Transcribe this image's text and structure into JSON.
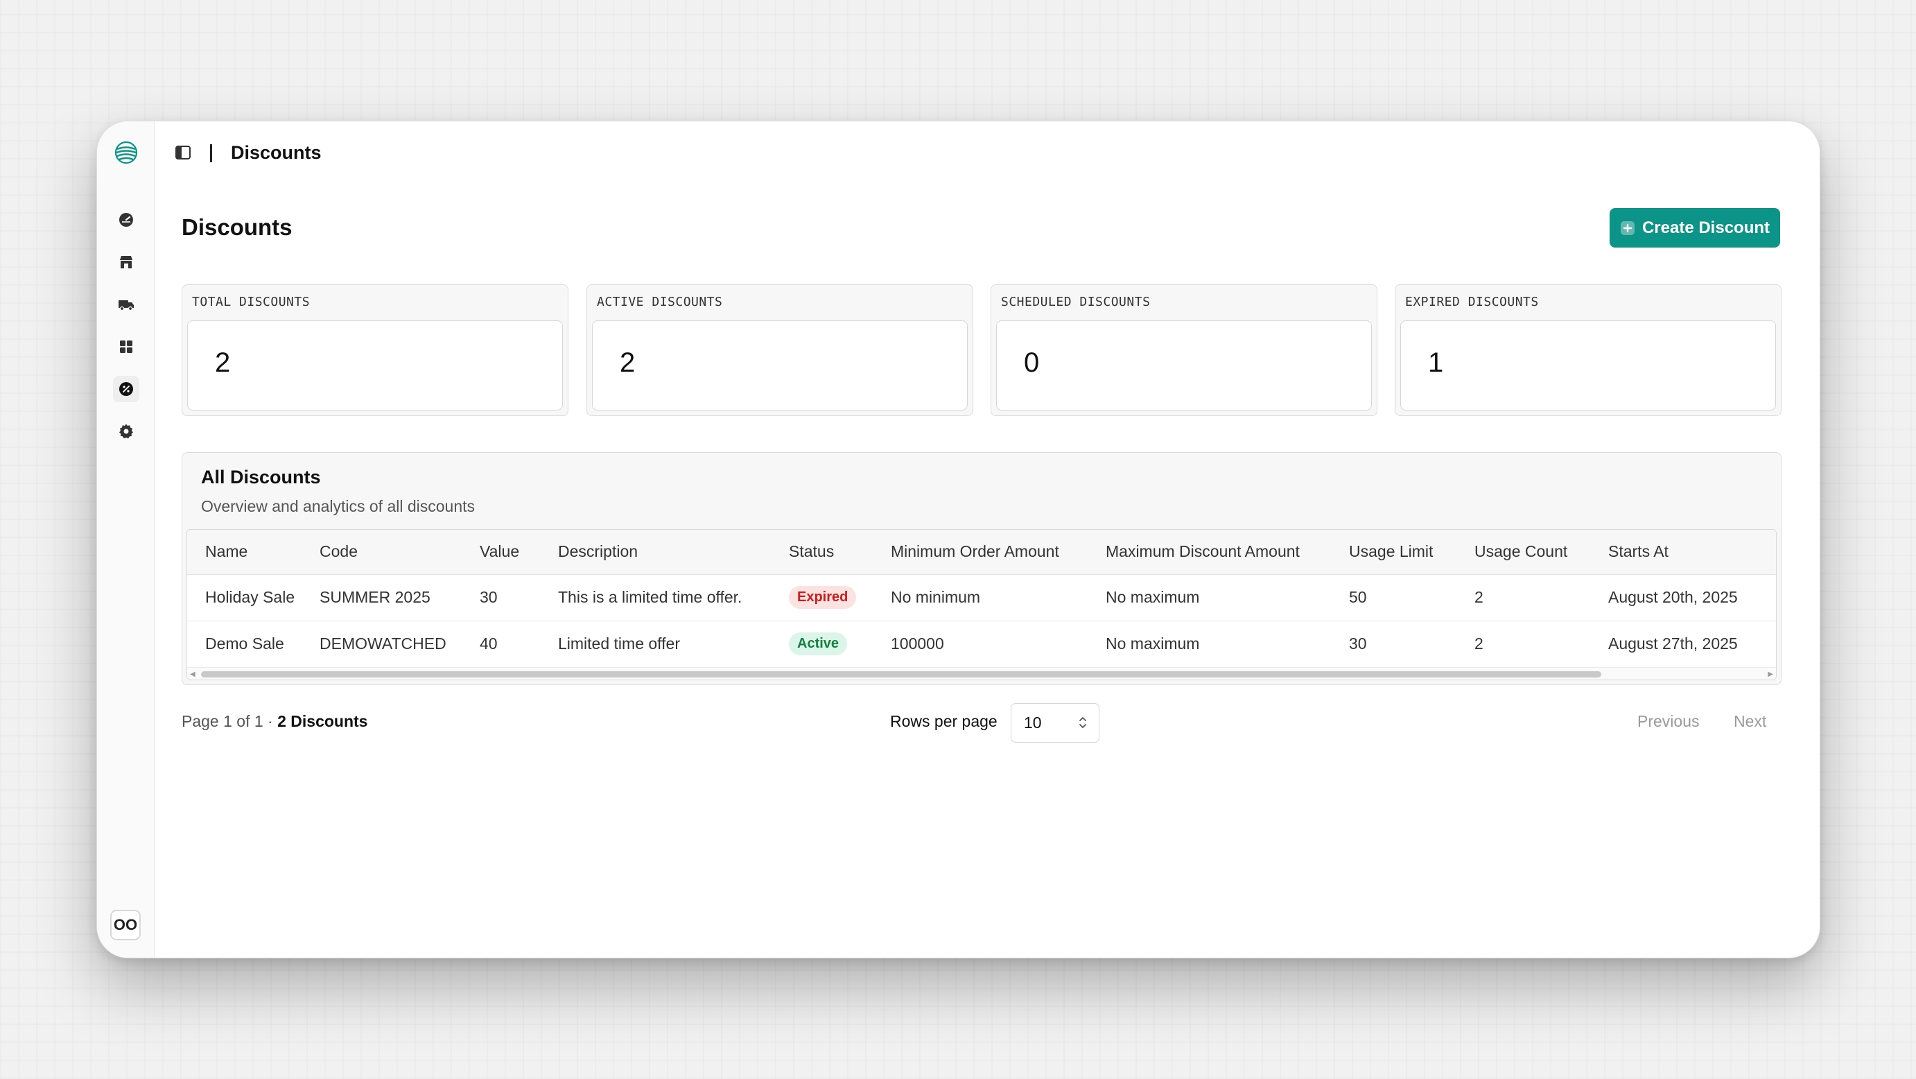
{
  "header": {
    "breadcrumb": "Discounts"
  },
  "page": {
    "title": "Discounts",
    "create_label": "Create Discount"
  },
  "stats": [
    {
      "label": "TOTAL DISCOUNTS",
      "value": "2"
    },
    {
      "label": "ACTIVE DISCOUNTS",
      "value": "2"
    },
    {
      "label": "SCHEDULED DISCOUNTS",
      "value": "0"
    },
    {
      "label": "EXPIRED DISCOUNTS",
      "value": "1"
    }
  ],
  "table": {
    "title": "All Discounts",
    "subtitle": "Overview and analytics of all discounts",
    "columns": [
      "Name",
      "Code",
      "Value",
      "Description",
      "Status",
      "Minimum Order Amount",
      "Maximum Discount Amount",
      "Usage Limit",
      "Usage Count",
      "Starts At"
    ],
    "rows": [
      [
        "Holiday Sale",
        "SUMMER 2025",
        "30",
        "This is a limited time offer.",
        "Expired",
        "No minimum",
        "No maximum",
        "50",
        "2",
        "August 20th, 2025"
      ],
      [
        "Demo Sale",
        "DEMOWATCHED",
        "40",
        "Limited time offer",
        "Active",
        "100000",
        "No maximum",
        "30",
        "2",
        "August 27th, 2025"
      ]
    ]
  },
  "pagination": {
    "page_text": "Page 1 of 1 · ",
    "count_text": "2 Discounts",
    "rows_per_page_label": "Rows per page",
    "rows_per_page_value": "10",
    "previous_label": "Previous",
    "next_label": "Next"
  },
  "sidebar": {
    "items": [
      "dashboard-icon",
      "store-icon",
      "delivery-truck-icon",
      "grid-icon",
      "discount-icon",
      "settings-icon"
    ],
    "active_item": "discount-icon",
    "bottom_badge": "OO"
  },
  "colors": {
    "accent": "#0d9488",
    "expired_bg": "#fde2e2",
    "expired_text": "#c81e1e",
    "active_bg": "#dcf5ea",
    "active_text": "#15803d"
  }
}
